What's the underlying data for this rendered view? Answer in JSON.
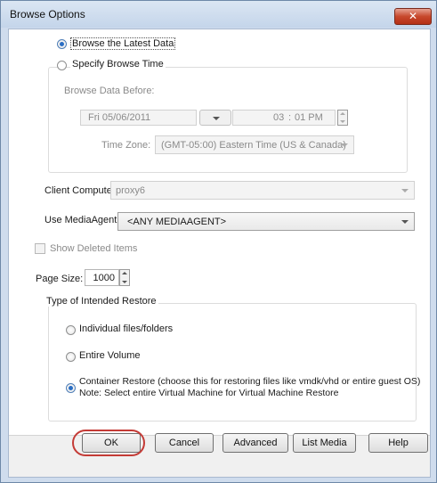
{
  "window": {
    "title": "Browse Options",
    "close_glyph": "✕"
  },
  "browse": {
    "latest_label": "Browse the Latest Data",
    "latest_checked": true,
    "specify_label": "Specify Browse Time",
    "specify_checked": false,
    "before_label": "Browse Data Before:",
    "date_value": "Fri 05/06/2011",
    "time_hour": "03",
    "time_sep": ":",
    "time_rest": "01 PM",
    "timezone_label": "Time Zone:",
    "timezone_value": "(GMT-05:00) Eastern Time (US & Canada)"
  },
  "client": {
    "label": "Client Computer:",
    "value": "proxy6"
  },
  "media_agent": {
    "label": "Use MediaAgent",
    "value": "<ANY MEDIAAGENT>"
  },
  "deleted": {
    "label": "Show Deleted Items",
    "checked": false
  },
  "page_size": {
    "label": "Page Size:",
    "value": "1000"
  },
  "restore": {
    "group_label": "Type of Intended Restore",
    "options": [
      {
        "label": "Individual files/folders",
        "checked": false
      },
      {
        "label": "Entire Volume",
        "checked": false
      },
      {
        "label": "Container Restore (choose this for restoring files like vmdk/vhd or entire guest OS)",
        "checked": true
      }
    ],
    "note": "Note: Select entire Virtual Machine for Virtual Machine Restore"
  },
  "buttons": {
    "ok": "OK",
    "cancel": "Cancel",
    "advanced": "Advanced",
    "list_media": "List Media",
    "help": "Help"
  },
  "colors": {
    "title_bar": "#c4d5ea",
    "close_button": "#c7482c",
    "radio_selected": "#2a6ec4",
    "ok_highlight": "#c43b36"
  }
}
